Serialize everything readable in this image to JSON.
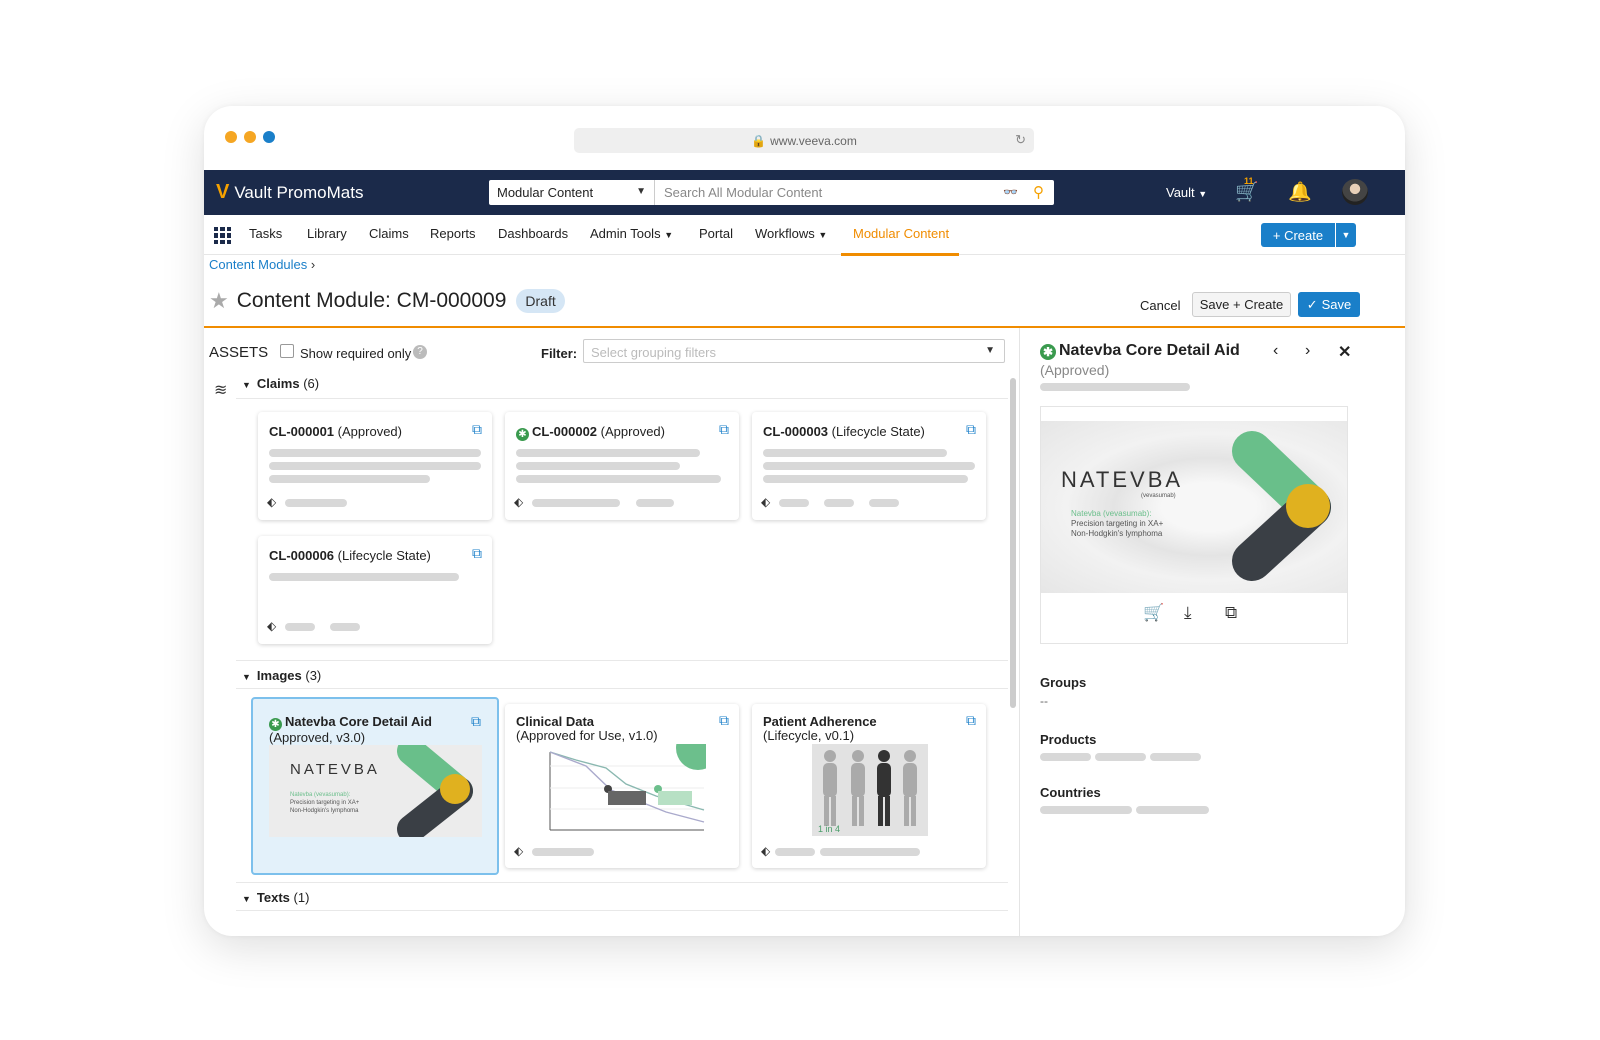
{
  "browser": {
    "url": "www.veeva.com",
    "dot_colors": [
      "#f5a623",
      "#f5a623",
      "#1a7fc9"
    ]
  },
  "topbar": {
    "brand": "Vault PromoMats",
    "object_select": "Modular Content",
    "search_placeholder": "Search All Modular Content",
    "vault_menu": "Vault",
    "cart_count": "11"
  },
  "nav": {
    "items": [
      "Tasks",
      "Library",
      "Claims",
      "Reports",
      "Dashboards",
      "Admin Tools",
      "Portal",
      "Workflows",
      "Modular Content"
    ],
    "active": "Modular Content",
    "create_label": "Create"
  },
  "page": {
    "breadcrumb": "Content Modules",
    "title": "Content Module: CM-000009",
    "status": "Draft",
    "cancel": "Cancel",
    "save_create": "Save + Create",
    "save": "Save"
  },
  "assets": {
    "label": "ASSETS",
    "show_required": "Show required only",
    "filter_label": "Filter:",
    "filter_placeholder": "Select grouping filters"
  },
  "claims": {
    "title": "Claims",
    "count": "(6)",
    "cards": [
      {
        "id": "CL-000001",
        "state": "(Approved)",
        "approved_icon": false
      },
      {
        "id": "CL-000002",
        "state": "(Approved)",
        "approved_icon": true
      },
      {
        "id": "CL-000003",
        "state": "(Lifecycle State)",
        "approved_icon": false
      },
      {
        "id": "CL-000006",
        "state": "(Lifecycle State)",
        "approved_icon": false
      }
    ]
  },
  "images": {
    "title": "Images",
    "count": "(3)",
    "cards": [
      {
        "name": "Natevba Core Detail Aid",
        "state": "(Approved, v3.0)"
      },
      {
        "name": "Clinical Data",
        "state": "(Approved for Use, v1.0)"
      },
      {
        "name": "Patient Adherence",
        "state": "(Lifecycle, v0.1)"
      }
    ]
  },
  "texts": {
    "title": "Texts",
    "count": "(1)"
  },
  "thumb_text": {
    "brand": "NATEVBA",
    "generic": "(vevasumab)",
    "line1": "Natevba (vevasumab):",
    "line2": "Precision targeting in XA+",
    "line3": "Non-Hodgkin's lymphoma",
    "stat": "1 in 4"
  },
  "detail": {
    "name": "Natevba Core Detail Aid",
    "status": "(Approved)",
    "groups_label": "Groups",
    "groups_value": "--",
    "products_label": "Products",
    "countries_label": "Countries"
  },
  "colors": {
    "topbar": "#1b2a4a",
    "accent": "#f08c00",
    "primary": "#1a7fc9",
    "approved": "#3a9a4e"
  }
}
